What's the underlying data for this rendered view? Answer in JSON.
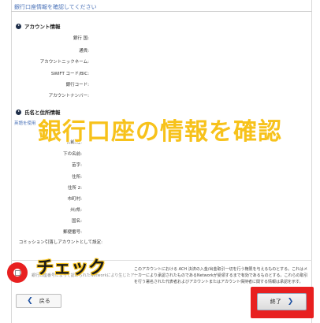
{
  "header": {
    "title": "銀行口座情報を確認してください"
  },
  "account_section": {
    "heading": "アカウント情報",
    "fields": [
      "銀行 国:",
      "通貨:",
      "アカウントニックネーム:",
      "SWIFT コード/BIC:",
      "銀行コード:",
      "アカウントナンバー:"
    ]
  },
  "address_section": {
    "heading": "氏名と住所情報",
    "use_english": "英語を使用",
    "fields": [
      "名前/姓:",
      "下の名前:",
      "苗字:",
      "住所:",
      "住所 2:",
      "市町村:",
      "州/県:",
      "国名:",
      "郵便番号:"
    ],
    "commission_label": "コミッション引落しアカウントとして設定:"
  },
  "overlay": {
    "title": "銀行口座の情報を確認",
    "check_label": "チェック"
  },
  "agreement": {
    "text": "このアカウントにおける ACH 決済の入金/出金取引一切を行う権限を与えるものとする。これはメ ーカーにより承認されたものであるNetworkが受領するまで有効であるものとする。これらの取引を行う署名された代表者およびアカウントまたはアカウント保持者に関する情報は承認を示す。",
    "faint": "銀行口座番号によって認められたNetworkにより生じたアカウントの正式な署名者であるものとし"
  },
  "buttons": {
    "back": "戻る",
    "finish": "終了"
  },
  "colors": {
    "overlay_title": "#f7c21b",
    "highlight": "#e82020",
    "link": "#4a72b8"
  }
}
